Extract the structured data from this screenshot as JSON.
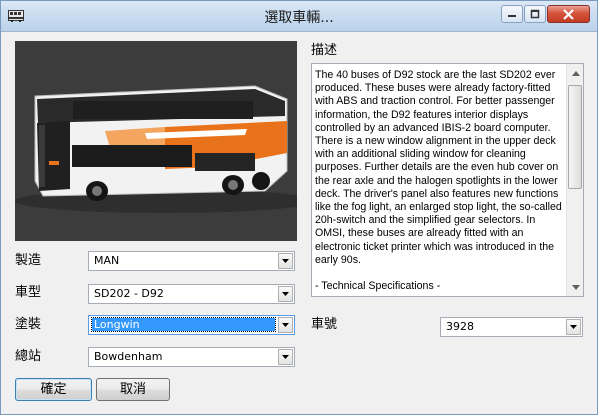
{
  "window": {
    "title": "選取車輛...",
    "controls": [
      "minimize-icon",
      "maximize-icon",
      "close-icon"
    ]
  },
  "description": {
    "label": "描述",
    "text": "The 40 buses of D92 stock are the last SD202 ever produced. These buses were already factory-fitted with ABS and traction control. For better passenger information, the D92 features interior displays controlled by an advanced IBIS-2 board computer. There is a new window alignment in the upper deck with an additional sliding window for cleaning purposes. Further details are the even hub cover on the rear axle and the halogen spotlights in the lower deck. The driver's panel also features new functions like the fog light, an enlarged stop light, the so-called 20h-switch and the simplified gear selectors. In OMSI, these buses are already fitted with an electronic ticket printer which was introduced in the early 90s.\n\n- Technical Specifications -"
  },
  "fields": {
    "manufacturer": {
      "label": "製造",
      "value": "MAN"
    },
    "model": {
      "label": "車型",
      "value": "SD202 - D92"
    },
    "livery": {
      "label": "塗裝",
      "value": "Longwin"
    },
    "depot": {
      "label": "總站",
      "value": "Bowdenham"
    },
    "fleet_number": {
      "label": "車號",
      "value": "3928"
    }
  },
  "buttons": {
    "ok": "確定",
    "cancel": "取消"
  },
  "colors": {
    "accent": "#3399ff",
    "bus_orange": "#e8731a",
    "preview_bg": "#3c3c3c"
  }
}
